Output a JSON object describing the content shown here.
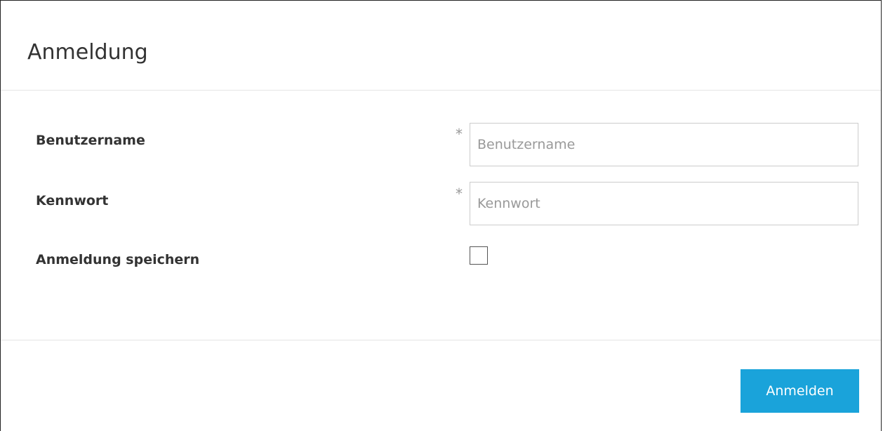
{
  "dialog": {
    "title": "Anmeldung"
  },
  "form": {
    "username": {
      "label": "Benutzername",
      "required_marker": "*",
      "placeholder": "Benutzername",
      "value": ""
    },
    "password": {
      "label": "Kennwort",
      "required_marker": "*",
      "placeholder": "Kennwort",
      "value": ""
    },
    "remember": {
      "label": "Anmeldung speichern",
      "checked": false
    }
  },
  "footer": {
    "submit_label": "Anmelden"
  },
  "colors": {
    "accent": "#1aa3da",
    "text": "#333333",
    "placeholder": "#999999",
    "divider": "#e5e5e5"
  }
}
